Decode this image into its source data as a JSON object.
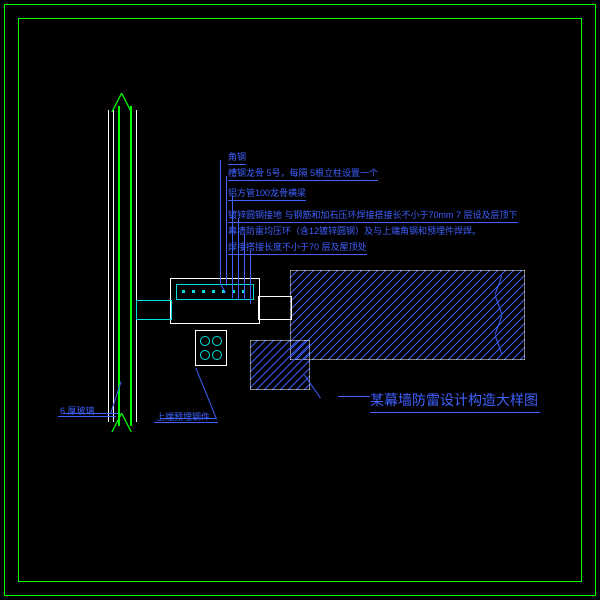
{
  "drawing": {
    "title": "某幕墙防雷设计构造大样图",
    "labels": {
      "glass": "6 厚玻璃",
      "embed": "上端预埋钢件",
      "l1": "角钢",
      "l2": "槽钢龙骨 5号，每隔 5根立柱设置一个",
      "l3": "铝方管100龙骨横梁",
      "l4": "镀锌圆钢接地 与钢筋和加石压环焊接搭接长不小于70mm 7 层设及层顶下",
      "l5": "幕墙防雷均压环（含12镀锌圆钢）及与上端角钢和预埋件焊焊。",
      "l6": "焊接搭接长度不小于70        层及屋顶处"
    },
    "icons": {
      "break": "break-line-icon",
      "hatch": "concrete-hatch-icon"
    }
  }
}
